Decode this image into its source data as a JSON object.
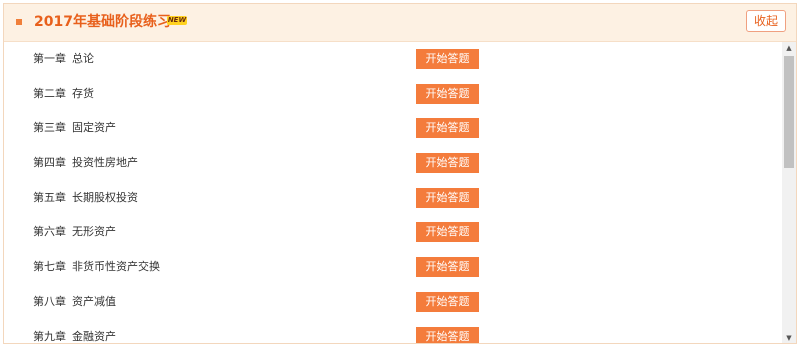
{
  "header": {
    "title": "2017年基础阶段练习",
    "badge": "NEW",
    "collapse_label": "收起",
    "accent_color": "#e8601c"
  },
  "chapters": [
    {
      "num": "第一章",
      "name": "总论",
      "button": "开始答题"
    },
    {
      "num": "第二章",
      "name": "存货",
      "button": "开始答题"
    },
    {
      "num": "第三章",
      "name": "固定资产",
      "button": "开始答题"
    },
    {
      "num": "第四章",
      "name": "投资性房地产",
      "button": "开始答题"
    },
    {
      "num": "第五章",
      "name": "长期股权投资",
      "button": "开始答题"
    },
    {
      "num": "第六章",
      "name": "无形资产",
      "button": "开始答题"
    },
    {
      "num": "第七章",
      "name": "非货币性资产交换",
      "button": "开始答题"
    },
    {
      "num": "第八章",
      "name": "资产减值",
      "button": "开始答题"
    },
    {
      "num": "第九章",
      "name": "金融资产",
      "button": "开始答题"
    }
  ],
  "scrollbar": {
    "up_icon": "triangle-up-icon",
    "down_icon": "triangle-down-icon"
  },
  "colors": {
    "button_bg": "#f47c3c",
    "header_bg": "#fdf1e3"
  }
}
